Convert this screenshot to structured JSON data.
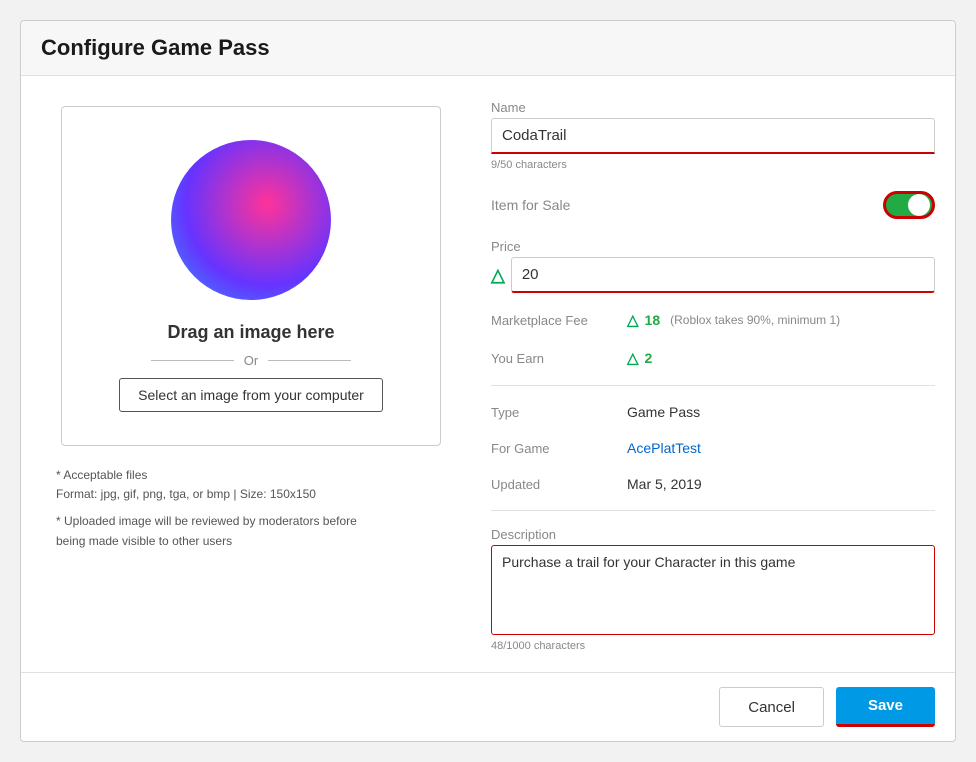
{
  "dialog": {
    "title": "Configure Game Pass"
  },
  "left": {
    "drag_text": "Drag an image here",
    "or_text": "Or",
    "select_button_label": "Select an image from your computer",
    "file_notes_line1": "* Acceptable files",
    "file_notes_line2": "Format: jpg, gif, png, tga, or bmp | Size: 150x150",
    "file_notes_line3": "",
    "file_notes_line4": "* Uploaded image will be reviewed by moderators before",
    "file_notes_line5": "being made visible to other users"
  },
  "right": {
    "name_label": "Name",
    "name_value": "CodaTrail",
    "name_char_count": "9/50 characters",
    "item_for_sale_label": "Item for Sale",
    "price_label": "Price",
    "price_value": "20",
    "marketplace_fee_label": "Marketplace Fee",
    "marketplace_fee_value": "18",
    "marketplace_fee_note": "(Roblox takes 90%, minimum 1)",
    "you_earn_label": "You Earn",
    "you_earn_value": "2",
    "type_label": "Type",
    "type_value": "Game Pass",
    "for_game_label": "For Game",
    "for_game_value": "AcePlatTest",
    "updated_label": "Updated",
    "updated_value": "Mar 5, 2019",
    "description_label": "Description",
    "description_value": "Purchase a trail for your Character in this game",
    "description_char_count": "48/1000 characters"
  },
  "footer": {
    "cancel_label": "Cancel",
    "save_label": "Save"
  }
}
